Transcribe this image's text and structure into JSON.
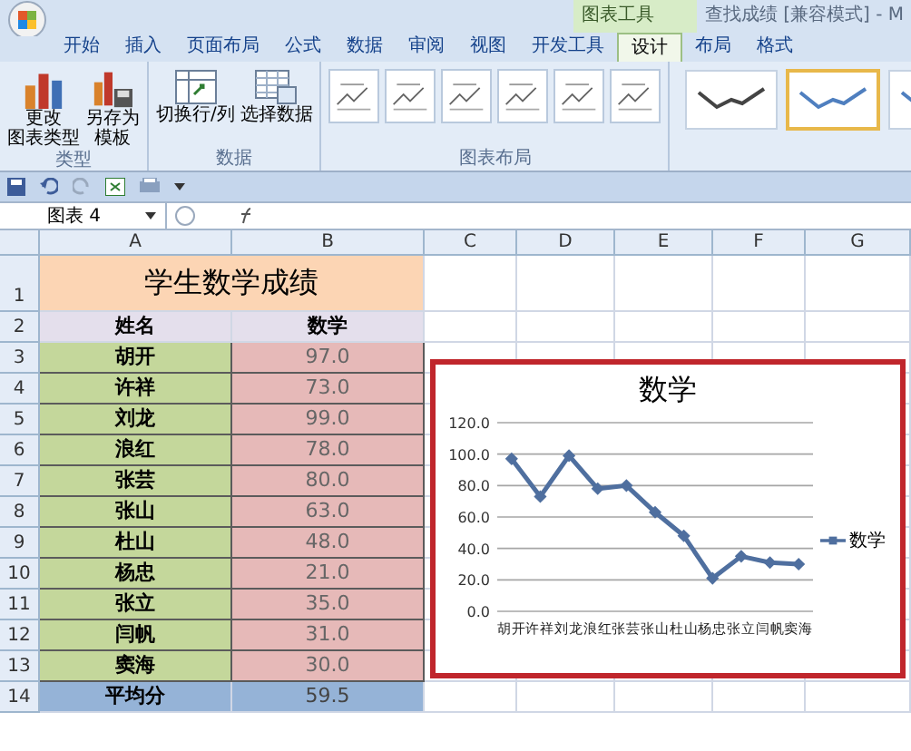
{
  "window": {
    "title": "查找成绩 [兼容模式] - M",
    "context_group": "图表工具"
  },
  "ribbon_tabs": [
    {
      "label": "开始",
      "selected": false
    },
    {
      "label": "插入",
      "selected": false
    },
    {
      "label": "页面布局",
      "selected": false
    },
    {
      "label": "公式",
      "selected": false
    },
    {
      "label": "数据",
      "selected": false
    },
    {
      "label": "审阅",
      "selected": false
    },
    {
      "label": "视图",
      "selected": false
    },
    {
      "label": "开发工具",
      "selected": false
    },
    {
      "label": "设计",
      "selected": true
    },
    {
      "label": "布局",
      "selected": false
    },
    {
      "label": "格式",
      "selected": false
    }
  ],
  "ribbon_groups": [
    {
      "label": "类型",
      "buttons": [
        {
          "lines": [
            "更改",
            "图表类型"
          ],
          "kind": "chart"
        },
        {
          "lines": [
            "另存为",
            "模板"
          ],
          "kind": "save"
        }
      ]
    },
    {
      "label": "数据",
      "buttons": [
        {
          "lines": [
            "切换行/列"
          ],
          "kind": "switch"
        },
        {
          "lines": [
            "选择数据"
          ],
          "kind": "select"
        }
      ]
    },
    {
      "label": "图表布局"
    }
  ],
  "chart_styles": [
    {
      "selected": false
    },
    {
      "selected": true
    },
    {
      "selected": false
    }
  ],
  "name_box": "图表 4",
  "sheet": {
    "columns": [
      "A",
      "B",
      "C",
      "D",
      "E",
      "F",
      "G"
    ],
    "row_numbers": [
      "1",
      "2",
      "3",
      "4",
      "5",
      "6",
      "7",
      "8",
      "9",
      "10",
      "11",
      "12",
      "13",
      "14"
    ],
    "title": "学生数学成绩",
    "headers": [
      "姓名",
      "数学"
    ],
    "rows": [
      {
        "name": "胡开",
        "score": "97.0"
      },
      {
        "name": "许祥",
        "score": "73.0"
      },
      {
        "name": "刘龙",
        "score": "99.0"
      },
      {
        "name": "浪红",
        "score": "78.0"
      },
      {
        "name": "张芸",
        "score": "80.0"
      },
      {
        "name": "张山",
        "score": "63.0"
      },
      {
        "name": "杜山",
        "score": "48.0"
      },
      {
        "name": "杨忠",
        "score": "21.0"
      },
      {
        "name": "张立",
        "score": "35.0"
      },
      {
        "name": "闫帆",
        "score": "31.0"
      },
      {
        "name": "窦海",
        "score": "30.0"
      }
    ],
    "footer": {
      "label": "平均分",
      "value": "59.5"
    }
  },
  "chart": {
    "chart_data": {
      "type": "line",
      "title": "数学",
      "categories": [
        "胡开",
        "许祥",
        "刘龙",
        "浪红",
        "张芸",
        "张山",
        "杜山",
        "杨忠",
        "张立",
        "闫帆",
        "窦海"
      ],
      "series": [
        {
          "name": "数学",
          "color": "#4f6f9f",
          "values": [
            97,
            73,
            99,
            78,
            80,
            63,
            48,
            21,
            35,
            31,
            30
          ]
        }
      ],
      "ylim": [
        0,
        120
      ],
      "yticks": [
        {
          "value": 0,
          "label": "0.0"
        },
        {
          "value": 20,
          "label": "20.0"
        },
        {
          "value": 40,
          "label": "40.0"
        },
        {
          "value": 60,
          "label": "60.0"
        },
        {
          "value": 80,
          "label": "80.0"
        },
        {
          "value": 100,
          "label": "100.0"
        },
        {
          "value": 120,
          "label": "120.0"
        }
      ],
      "grid": true,
      "marker": "diamond"
    }
  }
}
